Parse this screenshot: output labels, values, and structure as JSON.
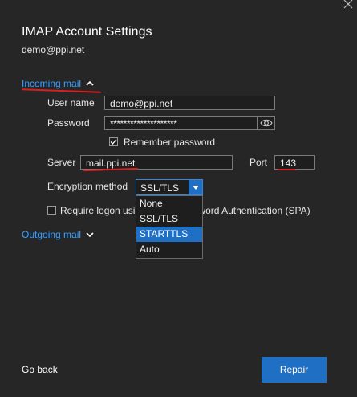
{
  "window": {
    "title": "IMAP Account Settings",
    "account": "demo@ppi.net"
  },
  "sections": {
    "incoming": "Incoming mail",
    "outgoing": "Outgoing mail"
  },
  "form": {
    "username_label": "User name",
    "username_value": "demo@ppi.net",
    "password_label": "Password",
    "password_value": "********************",
    "remember_label": "Remember password",
    "remember_checked": true,
    "server_label": "Server",
    "server_value": "mail.ppi.net",
    "port_label": "Port",
    "port_value": "143",
    "encryption_label": "Encryption method",
    "encryption_value": "SSL/TLS",
    "encryption_options": [
      "None",
      "SSL/TLS",
      "STARTTLS",
      "Auto"
    ],
    "encryption_highlighted": "STARTTLS",
    "spa_label_start": "Require logon usi",
    "spa_label_end": "word Authentication (SPA)",
    "spa_checked": false
  },
  "footer": {
    "go_back": "Go back",
    "repair": "Repair"
  },
  "colors": {
    "accent": "#1f6fc4",
    "link": "#3aa0ff",
    "annotation": "#d91f1f",
    "background": "#262626"
  },
  "icons": {
    "close": "close-icon",
    "eye": "eye-icon",
    "chevron_up": "chevron-up-icon",
    "chevron_down": "chevron-down-icon",
    "check": "checkmark-icon",
    "dropdown": "dropdown-arrow-icon"
  }
}
